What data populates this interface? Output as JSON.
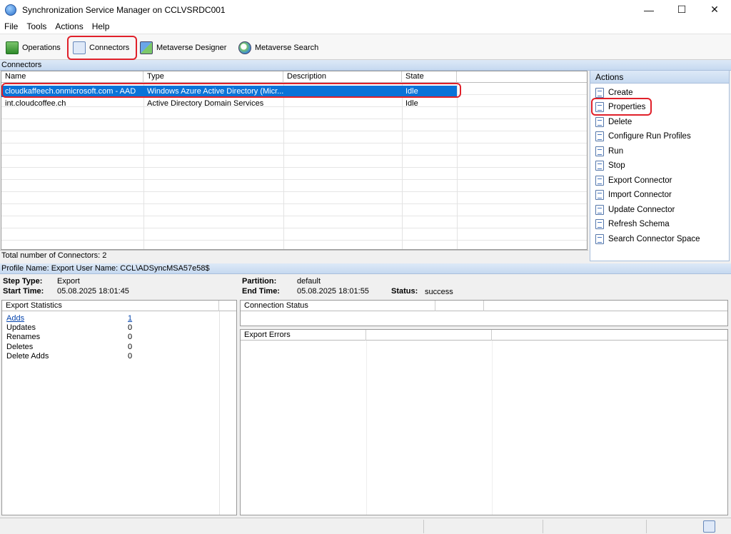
{
  "window": {
    "title": "Synchronization Service Manager on CCLVSRDC001",
    "minimize": "—",
    "maximize": "☐",
    "close": "✕"
  },
  "menu": [
    "File",
    "Tools",
    "Actions",
    "Help"
  ],
  "toolbar": {
    "operations": "Operations",
    "connectors": "Connectors",
    "metaverse_designer": "Metaverse Designer",
    "metaverse_search": "Metaverse Search"
  },
  "connectors": {
    "section_title": "Connectors",
    "columns": [
      "Name",
      "Type",
      "Description",
      "State"
    ],
    "rows": [
      {
        "name": "cloudkaffeech.onmicrosoft.com - AAD",
        "type": "Windows Azure Active Directory (Micr...",
        "description": "",
        "state": "Idle"
      },
      {
        "name": "int.cloudcoffee.ch",
        "type": "Active Directory Domain Services",
        "description": "",
        "state": "Idle"
      }
    ],
    "total": "Total number of Connectors: 2"
  },
  "actions": {
    "title": "Actions",
    "items": [
      "Create",
      "Properties",
      "Delete",
      "Configure Run Profiles",
      "Run",
      "Stop",
      "Export Connector",
      "Import Connector",
      "Update Connector",
      "Refresh Schema",
      "Search Connector Space"
    ]
  },
  "profile": {
    "header": "Profile Name: Export  User Name: CCL\\ADSyncMSA57e58$",
    "step_type_label": "Step Type:",
    "step_type": "Export",
    "start_time_label": "Start Time:",
    "start_time": "05.08.2025 18:01:45",
    "partition_label": "Partition:",
    "partition": "default",
    "end_time_label": "End Time:",
    "end_time": "05.08.2025 18:01:55",
    "status_label": "Status:",
    "status": "success"
  },
  "export_statistics": {
    "title": "Export Statistics",
    "rows": [
      {
        "label": "Adds",
        "value": "1"
      },
      {
        "label": "Updates",
        "value": "0"
      },
      {
        "label": "Renames",
        "value": "0"
      },
      {
        "label": "Deletes",
        "value": "0"
      },
      {
        "label": "Delete Adds",
        "value": "0"
      }
    ]
  },
  "connection_status": {
    "title": "Connection Status"
  },
  "export_errors": {
    "title": "Export Errors"
  },
  "colors": {
    "selection": "#0a73d8",
    "highlight": "#e0202a",
    "section": "#c6d9f0"
  }
}
